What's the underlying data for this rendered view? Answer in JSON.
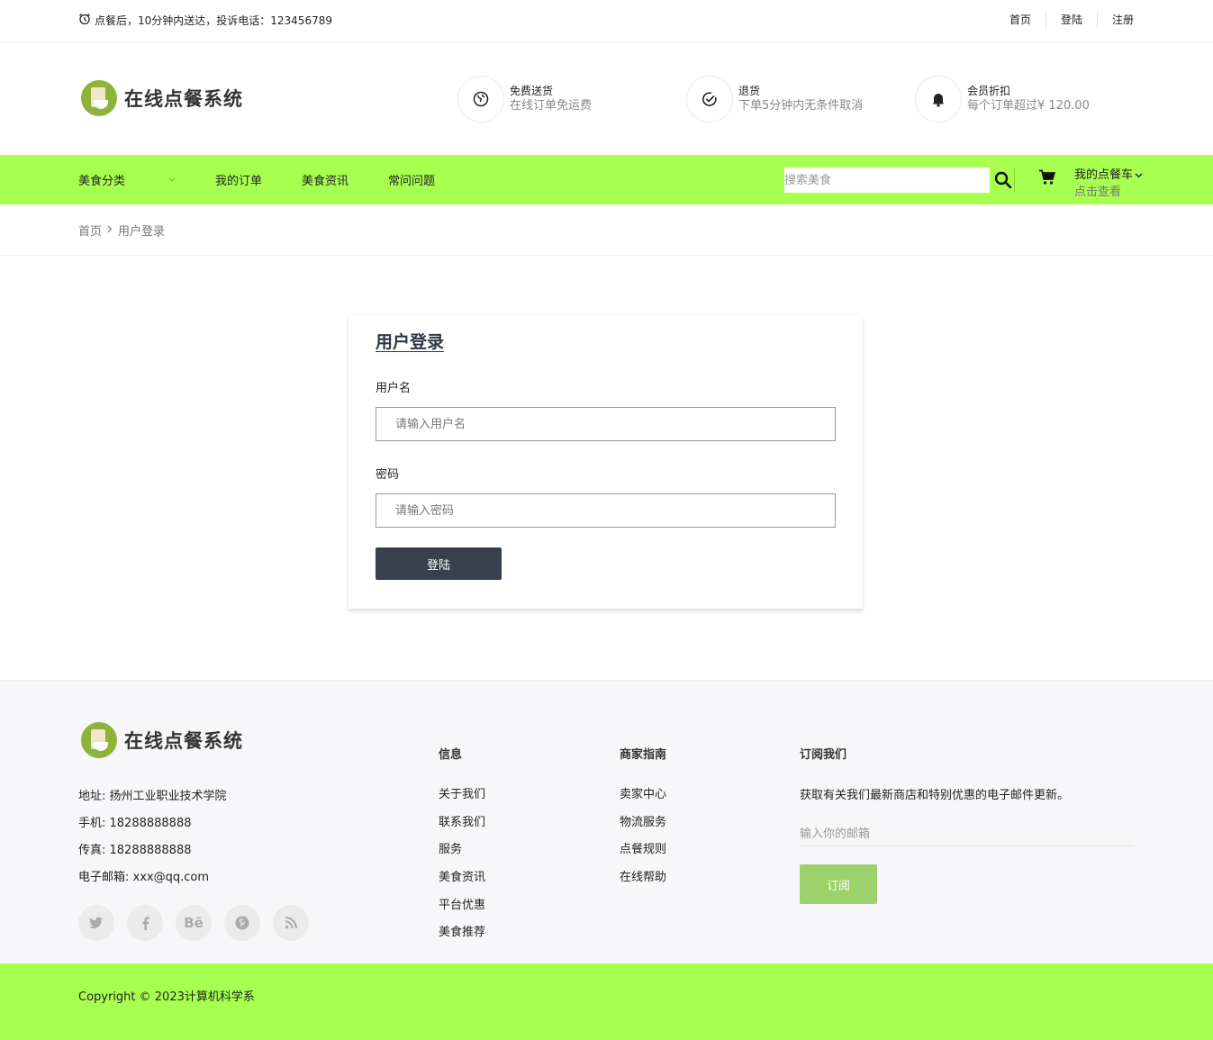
{
  "topbar": {
    "notice": "点餐后，10分钟内送达，投诉电话：123456789",
    "links": [
      "首页",
      "登陆",
      "注册"
    ]
  },
  "header": {
    "logo_text": "在线点餐系统",
    "features": [
      {
        "icon": "globe-icon",
        "title": "免费送货",
        "desc": "在线订单免运费"
      },
      {
        "icon": "check-circle-icon",
        "title": "退货",
        "desc": "下单5分钟内无条件取消"
      },
      {
        "icon": "bell-icon",
        "title": "会员折扣",
        "desc": "每个订单超过¥ 120.00"
      }
    ]
  },
  "nav": {
    "items": [
      "美食分类",
      "我的订单",
      "美食资讯",
      "常问问题"
    ],
    "search_placeholder": "搜索美食",
    "cart_title": "我的点餐车",
    "cart_sub": "点击查看"
  },
  "breadcrumb": {
    "home": "首页",
    "current": "用户登录"
  },
  "login": {
    "title": "用户登录",
    "username_label": "用户名",
    "username_placeholder": "请输入用户名",
    "password_label": "密码",
    "password_placeholder": "请输入密码",
    "submit_label": "登陆"
  },
  "footer": {
    "logo_text": "在线点餐系统",
    "contact": [
      "地址: 扬州工业职业技术学院",
      "手机: 18288888888",
      "传真: 18288888888",
      "电子邮箱: xxx@qq.com"
    ],
    "social": [
      "twitter-icon",
      "facebook-icon",
      "behance-icon",
      "pinterest-icon",
      "rss-icon"
    ],
    "info_title": "信息",
    "info_items": [
      "关于我们",
      "联系我们",
      "服务",
      "美食资讯",
      "平台优惠",
      "美食推荐"
    ],
    "merchant_title": "商家指南",
    "merchant_items": [
      "卖家中心",
      "物流服务",
      "点餐规则",
      "在线帮助"
    ],
    "subscribe_title": "订阅我们",
    "subscribe_text": "获取有关我们最新商店和特别优惠的电子邮件更新。",
    "subscribe_placeholder": "输入你的邮箱",
    "subscribe_button": "订阅"
  },
  "copyright": "Copyright © 2023计算机科学系",
  "colors": {
    "accent_green": "#a7ff4f",
    "button_dark": "#37404c",
    "subscribe_green": "#9dd16b"
  }
}
